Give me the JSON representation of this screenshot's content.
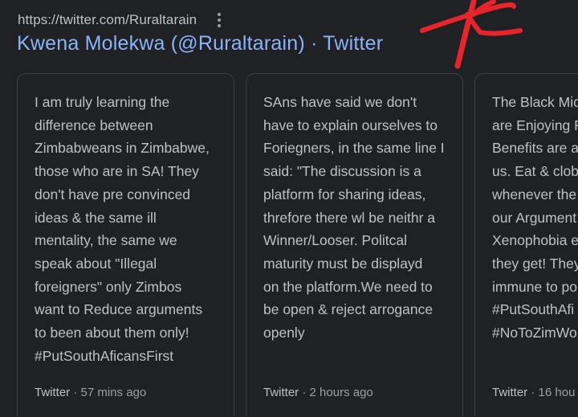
{
  "result": {
    "url": "https://twitter.com/Ruraltarain",
    "title": "Kwena Molekwa (@Ruraltarain) · Twitter"
  },
  "annotation": {
    "color": "#e8252a"
  },
  "cards": [
    {
      "text": "I am truly learning the\ndifference between\nZimbabweans in Zimbabwe,\nthose who are in SA! They\ndon't have pre convinced\nideas & the same ill\nmentality, the same we\nspeak about \"Illegal\nforeigners\" only Zimbos\nwant to Reduce arguments\nto been about them only!\n#PutSouthAficansFirst",
      "source": "Twitter",
      "separator": " · ",
      "time": "57 mins ago"
    },
    {
      "text": "SAns have said we don't\nhave to explain ourselves to\nForiegners, in the same line I\nsaid: \"The discussion is a\nplatform for sharing ideas,\nthrefore there wl be neithr a\nWinner/Looser. Politcal\nmaturity must be displayd\non the platform.We need to\nbe open & reject arrogance\nopenly",
      "source": "Twitter",
      "separator": " · ",
      "time": "2 hours ago"
    },
    {
      "text": "The Black Mic\nare Enjoying F\nBenefits are a\nus. Eat & clob\nwhenever the\nour Argument\nXenophobia e\nthey get! They\nimmune to po\n#PutSouthAfi\n#NoToZimWo",
      "source": "Twitter",
      "separator": " · ",
      "time": "16 hou"
    }
  ]
}
